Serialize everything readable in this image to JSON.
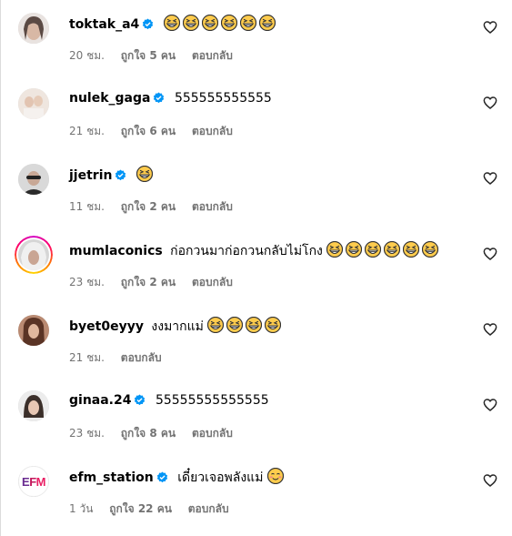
{
  "comments": [
    {
      "username": "toktak_a4",
      "verified": true,
      "text": "",
      "emoji_count": 6,
      "emoji": "grinning-squinting",
      "time": "20 ชม.",
      "likes": "ถูกใจ 5 คน",
      "reply": "ตอบกลับ"
    },
    {
      "username": "nulek_gaga",
      "verified": true,
      "text": "555555555555",
      "emoji_count": 0,
      "emoji": "",
      "time": "21 ชม.",
      "likes": "ถูกใจ 6 คน",
      "reply": "ตอบกลับ"
    },
    {
      "username": "jjetrin",
      "verified": true,
      "text": "",
      "emoji_count": 1,
      "emoji": "grinning-squinting",
      "time": "11 ชม.",
      "likes": "ถูกใจ 2 คน",
      "reply": "ตอบกลับ"
    },
    {
      "username": "mumlaconics",
      "verified": false,
      "text": "ก่อกวนมาก่อกวนกลับไม่โกง",
      "emoji_count": 6,
      "emoji": "grinning-squinting",
      "time": "23 ชม.",
      "likes": "ถูกใจ 2 คน",
      "reply": "ตอบกลับ"
    },
    {
      "username": "byet0eyyy",
      "verified": false,
      "text": "งงมากแม่",
      "emoji_count": 4,
      "emoji": "grinning-squinting",
      "time": "21 ชม.",
      "likes": "",
      "reply": "ตอบกลับ"
    },
    {
      "username": "ginaa.24",
      "verified": true,
      "text": "55555555555555",
      "emoji_count": 0,
      "emoji": "",
      "time": "23 ชม.",
      "likes": "ถูกใจ 8 คน",
      "reply": "ตอบกลับ"
    },
    {
      "username": "efm_station",
      "verified": true,
      "text": "เดี๋ยวเจอพลังแม่",
      "emoji_count": 1,
      "emoji": "smiling-blush",
      "time": "1 วัน",
      "likes": "ถูกใจ 22 คน",
      "reply": "ตอบกลับ"
    }
  ],
  "efm_logo": {
    "e": "E",
    "f": "F",
    "m": "M"
  },
  "colors": {
    "verified": "#0095f6",
    "meta_text": "#737373",
    "emoji_face": "#ffcc4d"
  }
}
